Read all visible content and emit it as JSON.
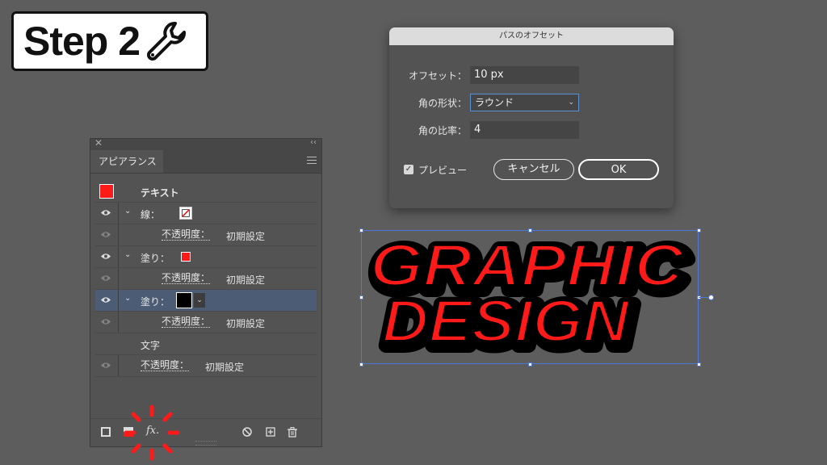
{
  "badge": {
    "text": "Step 2",
    "icon": "wrench-icon"
  },
  "appearance_panel": {
    "close_glyph": "✕",
    "collapse_glyph": "‹‹",
    "tab_label": "アピアランス",
    "menu_icon": "hamburger-menu-icon",
    "rows": [
      {
        "kind": "header",
        "label": "テキスト",
        "swatch": "#ff1a1a"
      },
      {
        "kind": "stroke",
        "label": "線：",
        "visible": true
      },
      {
        "kind": "opacity",
        "label": "不透明度：",
        "value": "初期設定",
        "visible": false
      },
      {
        "kind": "fill",
        "label": "塗り：",
        "swatch": "#ff1a1a",
        "visible": true
      },
      {
        "kind": "opacity",
        "label": "不透明度：",
        "value": "初期設定",
        "visible": false
      },
      {
        "kind": "fill",
        "label": "塗り：",
        "swatch": "#000000",
        "visible": true,
        "selected": true
      },
      {
        "kind": "opacity",
        "label": "不透明度：",
        "value": "初期設定",
        "visible": false
      },
      {
        "kind": "text",
        "label": "文字"
      },
      {
        "kind": "opacity",
        "label": "不透明度：",
        "value": "初期設定",
        "visible": false
      }
    ],
    "footer_icons": [
      "add-stroke-icon",
      "add-fill-icon",
      "fx-icon",
      "clear-icon",
      "duplicate-icon",
      "trash-icon"
    ],
    "fx_label": "fx."
  },
  "dialog": {
    "title": "パスのオフセット",
    "offset_label": "オフセット：",
    "offset_value": "10 px",
    "joins_label": "角の形状：",
    "joins_value": "ラウンド",
    "miter_label": "角の比率：",
    "miter_value": "4",
    "preview_label": "プレビュー",
    "preview_checked": true,
    "cancel_label": "キャンセル",
    "ok_label": "OK"
  },
  "artwork": {
    "line1": "GRAPHIC",
    "line2": "DESIGN",
    "fill_color": "#ff1a1a",
    "outline_color": "#000000"
  },
  "colors": {
    "accent_red": "#ff1a1a",
    "selection_blue": "#4d78d8"
  }
}
